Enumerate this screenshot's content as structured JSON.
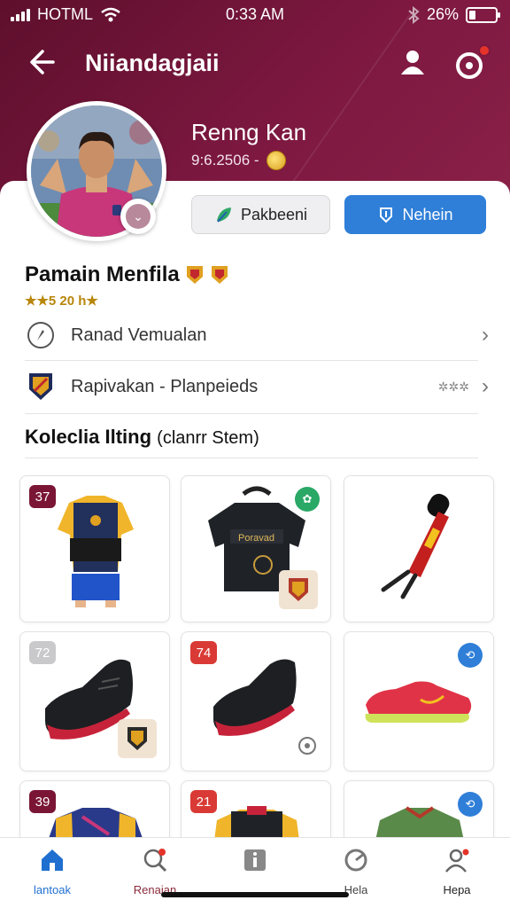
{
  "status": {
    "carrier": "HOTML",
    "time": "0:33 AM",
    "battery": "26%",
    "battery_fraction": 0.26
  },
  "header": {
    "title": "Niiandagjaii"
  },
  "profile": {
    "name": "Renng Kan",
    "meta": "9:6.2506 -"
  },
  "actions": {
    "secondary": "Pakbeeni",
    "primary": "Nehein"
  },
  "section": {
    "title": "Pamain Menfila",
    "rating": "★★5 20 h★"
  },
  "rows": [
    {
      "label": "Ranad Vemualan",
      "extra": ""
    },
    {
      "label": "Rapivakan - Planpeieds",
      "extra": "✲✲✲"
    }
  ],
  "collection": {
    "title_bold": "Koleclia Ilting",
    "title_sub": "(clanrr Stem)"
  },
  "items": [
    {
      "num": "37",
      "num_color": "#7a1535",
      "kind": "jersey"
    },
    {
      "num": "",
      "kind": "backpack",
      "corner_color": "#2aa866",
      "print": "Poravad"
    },
    {
      "num": "",
      "kind": "bat"
    },
    {
      "num": "72",
      "num_color": "#c9c9cc",
      "kind": "shoe-black"
    },
    {
      "num": "74",
      "num_color": "#d93a35",
      "kind": "shoe-black2"
    },
    {
      "num": "",
      "kind": "shoe-red",
      "corner_color": "#2f7fd8"
    },
    {
      "num": "39",
      "num_color": "#7a1535",
      "kind": "jersey2"
    },
    {
      "num": "21",
      "num_color": "#d93a35",
      "kind": "vest"
    },
    {
      "num": "",
      "kind": "jersey3",
      "corner_color": "#2f7fd8"
    }
  ],
  "nav": [
    {
      "label": "lantoak",
      "active": true
    },
    {
      "label": "Renaian"
    },
    {
      "label": ""
    },
    {
      "label": "Hela"
    },
    {
      "label": "Hepa"
    }
  ],
  "colors": {
    "brand": "#7d1840",
    "primary": "#2f7fd8",
    "active_nav": "#1f6fd0"
  }
}
